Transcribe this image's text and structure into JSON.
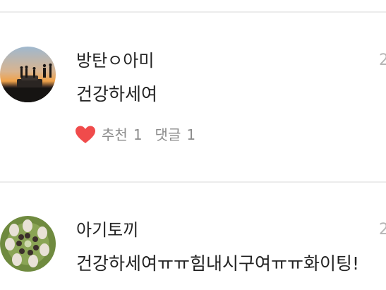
{
  "colors": {
    "heart": "#f04b4b",
    "divider": "#ececec",
    "meta_text": "#8c8c8c",
    "timestamp": "#b5b5b5"
  },
  "comments": [
    {
      "username": "방탄ㅇ아미",
      "timestamp": "2",
      "text": "건강하세여",
      "like_label": "추천",
      "like_count": "1",
      "reply_label": "댓글",
      "reply_count": "1",
      "like_icon": "heart-icon",
      "avatar": "silhouettes-at-sunset-avatar"
    },
    {
      "username": "아기토끼",
      "timestamp": "2",
      "text": "건강하세여ㅠㅠ힘내시구여ㅠㅠ화이팅!",
      "avatar": "group-photo-avatar"
    }
  ]
}
